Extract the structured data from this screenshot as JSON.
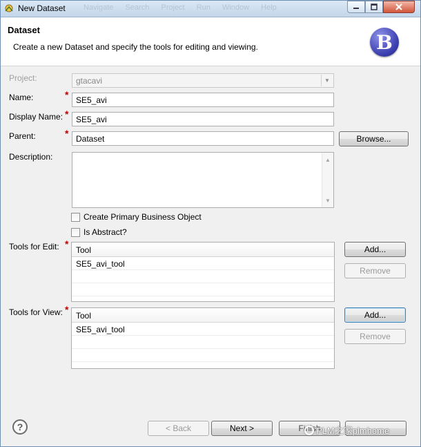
{
  "window": {
    "title": "New Dataset",
    "menu_ghost": "Navigate Search Project Run Window Help"
  },
  "header": {
    "title": "Dataset",
    "description": "Create a new Dataset and specify the tools for editing and viewing.",
    "logo_letter": "B"
  },
  "form": {
    "project": {
      "label": "Project:",
      "value": "gtacavi"
    },
    "name": {
      "label": "Name:",
      "value": "SE5_avi"
    },
    "display_name": {
      "label": "Display Name:",
      "value": "SE5_avi"
    },
    "parent": {
      "label": "Parent:",
      "value": "Dataset",
      "browse_label": "Browse..."
    },
    "description": {
      "label": "Description:",
      "value": ""
    },
    "required_marker": "*",
    "create_primary_bo": {
      "label": "Create Primary Business Object",
      "checked": false
    },
    "is_abstract": {
      "label": "Is Abstract?",
      "checked": false
    }
  },
  "tools_edit": {
    "label": "Tools for Edit:",
    "column": "Tool",
    "rows": [
      "SE5_avi_tool"
    ],
    "add_label": "Add...",
    "remove_label": "Remove"
  },
  "tools_view": {
    "label": "Tools for View:",
    "column": "Tool",
    "rows": [
      "SE5_avi_tool"
    ],
    "add_label": "Add...",
    "remove_label": "Remove"
  },
  "footer": {
    "back_label": "< Back",
    "next_label": "Next >",
    "finish_label": "Finish",
    "watermark": "PLM之家plmhome"
  },
  "colors": {
    "required": "#c00000",
    "logo": "#3c3fb0"
  }
}
